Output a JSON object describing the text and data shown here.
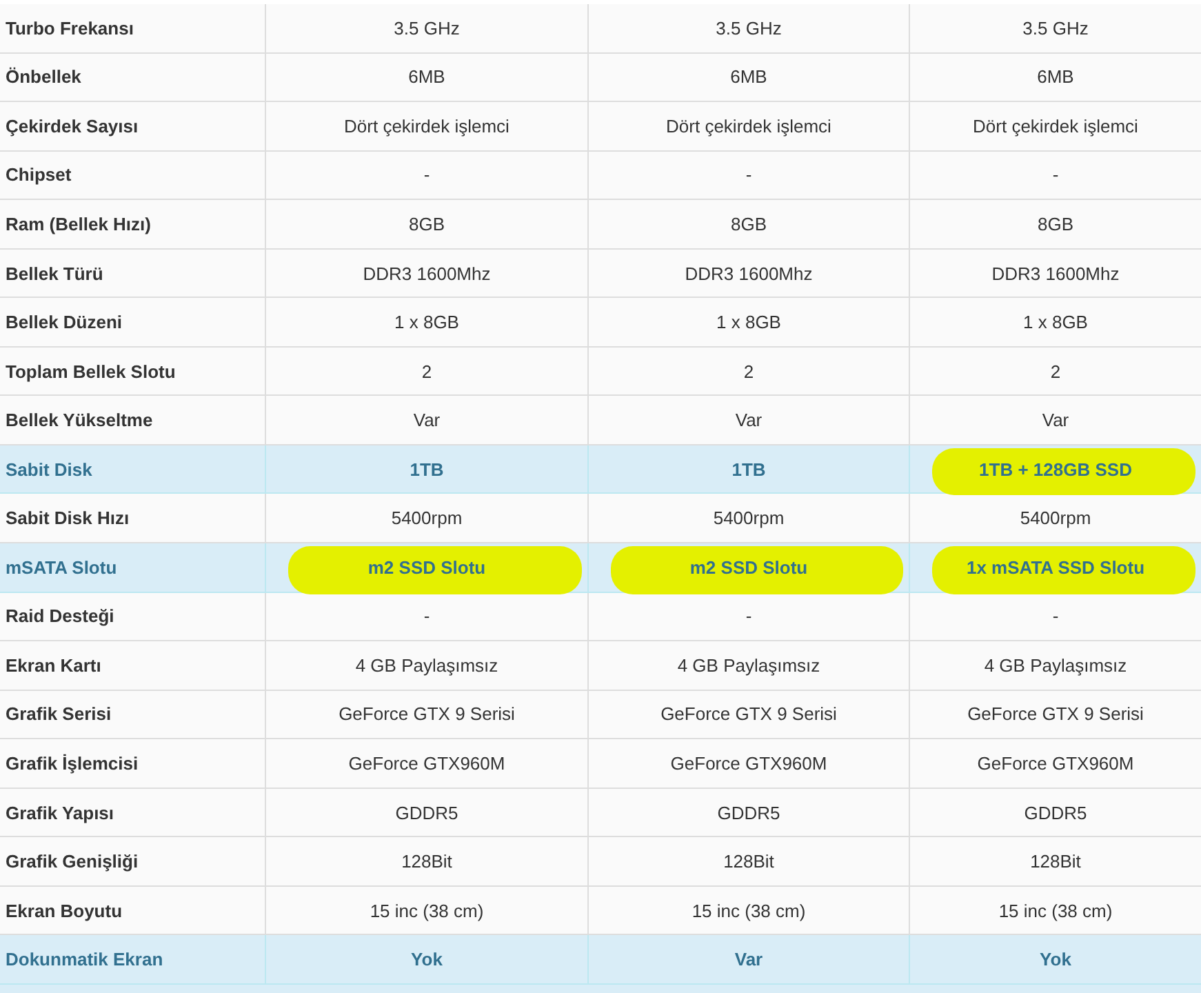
{
  "table": {
    "rows": [
      {
        "kind": "plain",
        "label": "Turbo Frekansı",
        "values": [
          {
            "text": "3.5 GHz"
          },
          {
            "text": "3.5 GHz"
          },
          {
            "text": "3.5 GHz"
          }
        ]
      },
      {
        "kind": "plain",
        "label": "Önbellek",
        "values": [
          {
            "text": "6MB"
          },
          {
            "text": "6MB"
          },
          {
            "text": "6MB"
          }
        ]
      },
      {
        "kind": "plain",
        "label": "Çekirdek Sayısı",
        "values": [
          {
            "text": "Dört çekirdek işlemci"
          },
          {
            "text": "Dört çekirdek işlemci"
          },
          {
            "text": "Dört çekirdek işlemci"
          }
        ]
      },
      {
        "kind": "plain",
        "label": "Chipset",
        "values": [
          {
            "text": "-"
          },
          {
            "text": "-"
          },
          {
            "text": "-"
          }
        ]
      },
      {
        "kind": "plain",
        "label": "Ram (Bellek Hızı)",
        "values": [
          {
            "text": "8GB"
          },
          {
            "text": "8GB"
          },
          {
            "text": "8GB"
          }
        ]
      },
      {
        "kind": "plain",
        "label": "Bellek Türü",
        "values": [
          {
            "text": "DDR3 1600Mhz"
          },
          {
            "text": "DDR3 1600Mhz"
          },
          {
            "text": "DDR3 1600Mhz"
          }
        ]
      },
      {
        "kind": "plain",
        "label": "Bellek Düzeni",
        "values": [
          {
            "text": "1 x 8GB"
          },
          {
            "text": "1 x 8GB"
          },
          {
            "text": "1 x 8GB"
          }
        ]
      },
      {
        "kind": "plain",
        "label": "Toplam Bellek Slotu",
        "values": [
          {
            "text": "2"
          },
          {
            "text": "2"
          },
          {
            "text": "2"
          }
        ]
      },
      {
        "kind": "plain",
        "label": "Bellek Yükseltme",
        "values": [
          {
            "text": "Var"
          },
          {
            "text": "Var"
          },
          {
            "text": "Var"
          }
        ]
      },
      {
        "kind": "featured",
        "label": "Sabit Disk",
        "values": [
          {
            "text": "1TB",
            "marked": false
          },
          {
            "text": "1TB",
            "marked": false
          },
          {
            "text": "1TB + 128GB SSD",
            "marked": true
          }
        ]
      },
      {
        "kind": "plain",
        "label": "Sabit Disk Hızı",
        "values": [
          {
            "text": "5400rpm"
          },
          {
            "text": "5400rpm"
          },
          {
            "text": "5400rpm"
          }
        ]
      },
      {
        "kind": "featured",
        "label": "mSATA Slotu",
        "values": [
          {
            "text": "m2 SSD Slotu",
            "marked": true
          },
          {
            "text": "m2 SSD Slotu",
            "marked": true
          },
          {
            "text": "1x mSATA SSD Slotu",
            "marked": true
          }
        ]
      },
      {
        "kind": "plain",
        "label": "Raid Desteği",
        "values": [
          {
            "text": "-"
          },
          {
            "text": "-"
          },
          {
            "text": "-"
          }
        ]
      },
      {
        "kind": "plain",
        "label": "Ekran Kartı",
        "values": [
          {
            "text": "4 GB Paylaşımsız"
          },
          {
            "text": "4 GB Paylaşımsız"
          },
          {
            "text": "4 GB Paylaşımsız"
          }
        ]
      },
      {
        "kind": "plain",
        "label": "Grafik Serisi",
        "values": [
          {
            "text": "GeForce GTX 9 Serisi"
          },
          {
            "text": "GeForce GTX 9 Serisi"
          },
          {
            "text": "GeForce GTX 9 Serisi"
          }
        ]
      },
      {
        "kind": "plain",
        "label": "Grafik İşlemcisi",
        "values": [
          {
            "text": "GeForce GTX960M"
          },
          {
            "text": "GeForce GTX960M"
          },
          {
            "text": "GeForce GTX960M"
          }
        ]
      },
      {
        "kind": "plain",
        "label": "Grafik Yapısı",
        "values": [
          {
            "text": "GDDR5"
          },
          {
            "text": "GDDR5"
          },
          {
            "text": "GDDR5"
          }
        ]
      },
      {
        "kind": "plain",
        "label": "Grafik Genişliği",
        "values": [
          {
            "text": "128Bit"
          },
          {
            "text": "128Bit"
          },
          {
            "text": "128Bit"
          }
        ]
      },
      {
        "kind": "plain",
        "label": "Ekran Boyutu",
        "values": [
          {
            "text": "15 inc (38 cm)"
          },
          {
            "text": "15 inc (38 cm)"
          },
          {
            "text": "15 inc (38 cm)"
          }
        ]
      },
      {
        "kind": "featured",
        "label": "Dokunmatik Ekran",
        "values": [
          {
            "text": "Yok",
            "marked": false
          },
          {
            "text": "Var",
            "marked": false
          },
          {
            "text": "Yok",
            "marked": false
          }
        ]
      },
      {
        "kind": "featured"
      }
    ]
  }
}
